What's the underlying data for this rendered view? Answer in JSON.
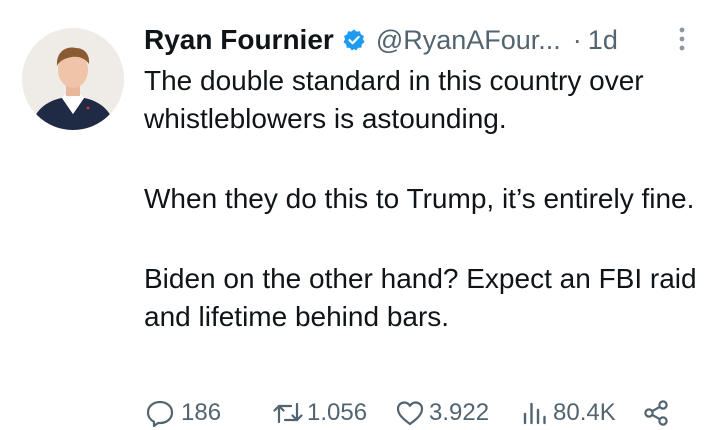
{
  "tweet": {
    "author": {
      "display_name": "Ryan Fournier",
      "handle": "@RyanAFour...",
      "verified": true
    },
    "separator": "·",
    "timestamp": "1d",
    "paragraphs": [
      "The double standard in this country over whistleblowers is astounding.",
      "When they do this to Trump, it’s entirely fine.",
      "Biden on the other hand? Expect an FBI raid and lifetime behind bars."
    ],
    "actions": {
      "replies": "186",
      "retweets": "1.056",
      "likes": "3.922",
      "views": "80.4K"
    },
    "icons": {
      "verified": "verified-badge-icon",
      "more": "more-vertical-icon",
      "reply": "reply-icon",
      "retweet": "retweet-icon",
      "like": "heart-icon",
      "views": "views-chart-icon",
      "share": "share-icon"
    },
    "colors": {
      "text": "#0f1419",
      "secondary": "#536471",
      "verified_blue": "#1d9bf0",
      "background": "#ffffff"
    }
  }
}
